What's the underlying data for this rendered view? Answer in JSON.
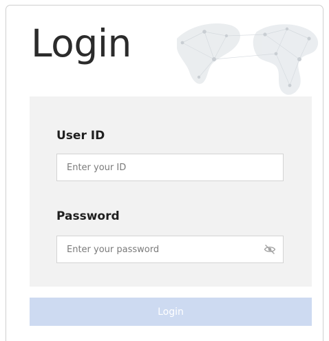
{
  "login": {
    "title": "Login",
    "user_id": {
      "label": "User ID",
      "placeholder": "Enter your ID",
      "value": ""
    },
    "password": {
      "label": "Password",
      "placeholder": "Enter your password",
      "value": "",
      "toggle_icon": "eye-slash-icon"
    },
    "submit_label": "Login"
  },
  "colors": {
    "panel_bg": "#f2f2f2",
    "button_bg": "#cddaf1",
    "button_text": "#ffffff",
    "title_text": "#2b2b2b"
  }
}
